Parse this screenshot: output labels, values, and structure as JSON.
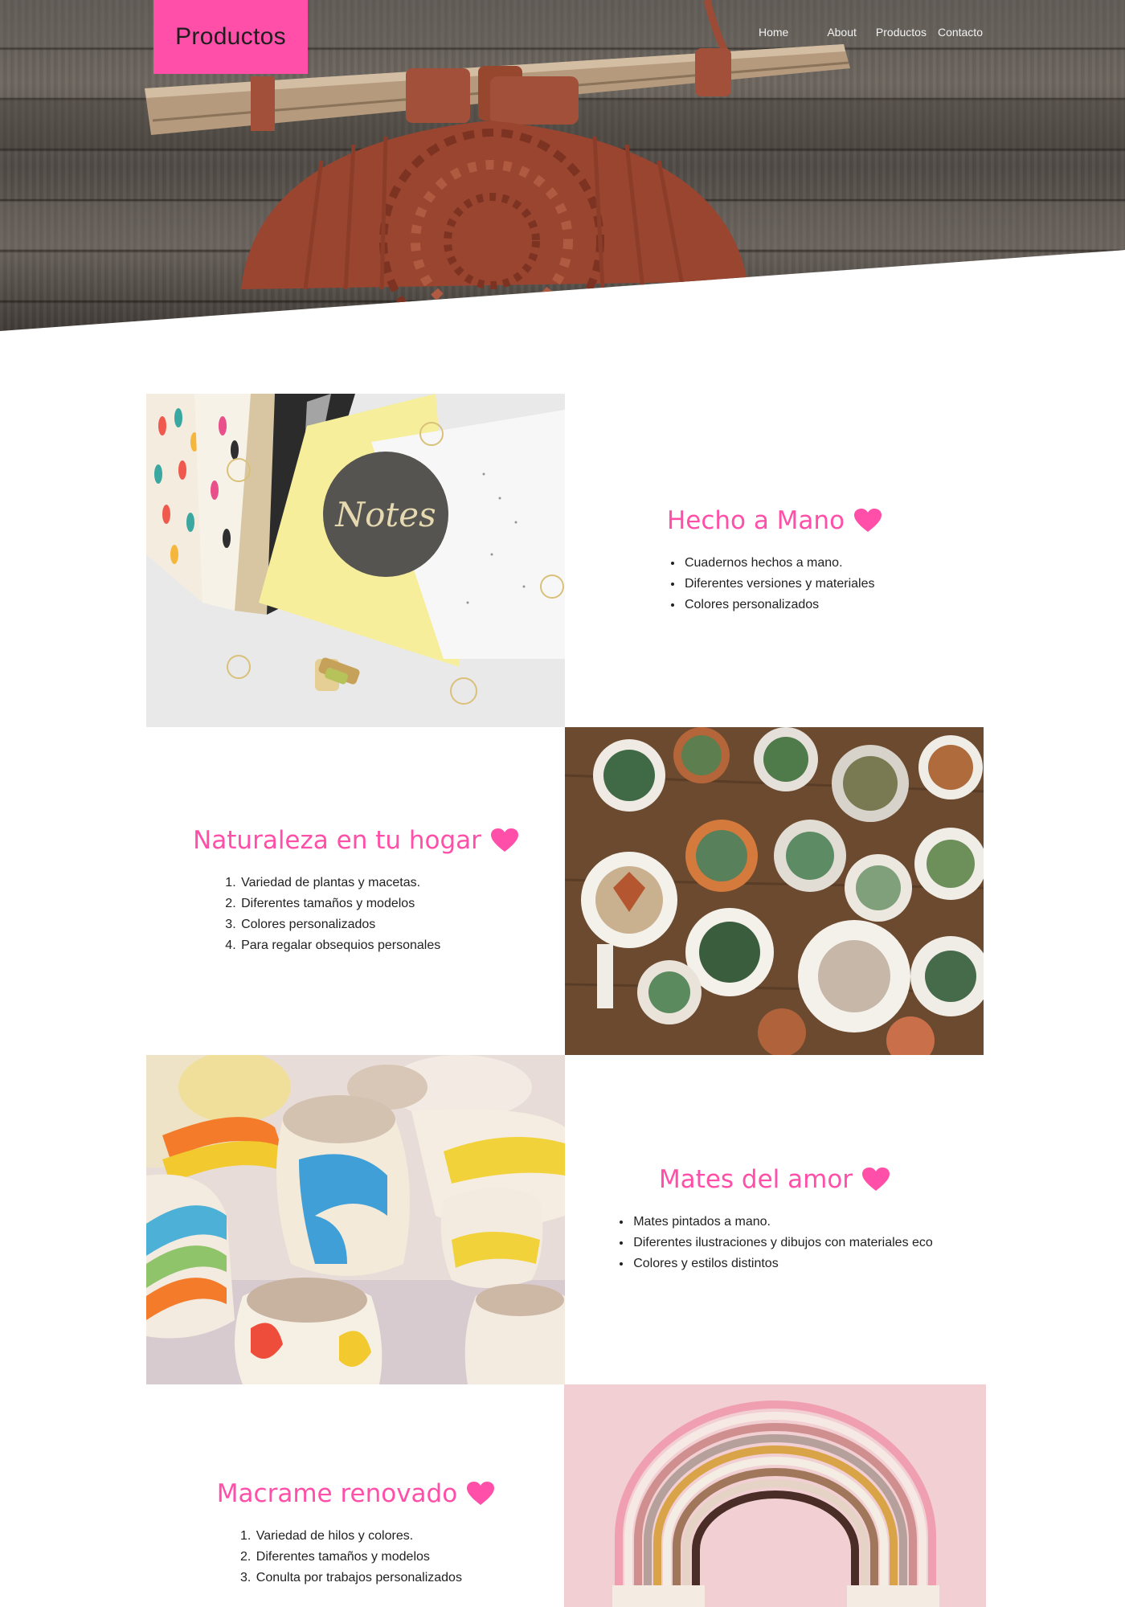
{
  "header": {
    "logo_text": "Productos",
    "nav": [
      "Home",
      "About",
      "Productos",
      "Contacto"
    ]
  },
  "colors": {
    "accent": "#ff4fa8",
    "text": "#222222",
    "nav_text": "#f2f2f2"
  },
  "sections": [
    {
      "title": "Hecho a Mano",
      "list_type": "bulleted",
      "items": [
        "Cuadernos hechos a mano.",
        "Diferentes versiones y materiales",
        "Colores personalizados"
      ],
      "image": "notebooks-photo"
    },
    {
      "title": "Naturaleza en tu hogar",
      "list_type": "numbered",
      "items": [
        "Variedad de plantas y macetas.",
        "Diferentes tamaños y modelos",
        "Colores personalizados",
        "Para regalar obsequios personales"
      ],
      "image": "succulents-photo"
    },
    {
      "title": "Mates del amor",
      "list_type": "bulleted",
      "items": [
        "Mates pintados a mano.",
        "Diferentes ilustraciones y dibujos con materiales eco",
        "Colores y estilos distintos"
      ],
      "image": "painted-mates-photo"
    },
    {
      "title": "Macrame renovado",
      "list_type": "numbered",
      "items": [
        "Variedad de hilos y colores.",
        "Diferentes tamaños y modelos",
        "Conulta por trabajos personalizados"
      ],
      "image": "rainbow-macrame-photo"
    }
  ],
  "icons": {
    "heart": "heart-icon"
  }
}
